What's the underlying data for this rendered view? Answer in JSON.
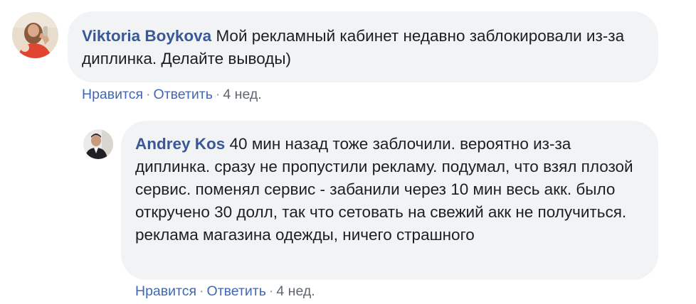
{
  "comments": [
    {
      "author": "Viktoria Boykova",
      "text": "Мой рекламный кабинет недавно заблокировали из-за диплинка. Делайте выводы)",
      "like_label": "Нравится",
      "reply_label": "Ответить",
      "separator": "·",
      "time": "4 нед."
    },
    {
      "author": "Andrey Kos",
      "text": "40 мин назад тоже заблочили. вероятно из-за диплинка. сразу не пропустили рекламу. подумал, что взял плозой сервис. поменял сервис - забанили через 10 мин весь акк. было откручено 30 долл, так что сетовать на свежий акк не получиться. реклама магазина одежды, ничего страшного",
      "like_label": "Нравится",
      "reply_label": "Ответить",
      "separator": "·",
      "time": "4 нед."
    }
  ],
  "colors": {
    "bubble_bg": "#f2f3f5",
    "author": "#385898",
    "action_link": "#4267b2",
    "meta": "#90949c"
  }
}
